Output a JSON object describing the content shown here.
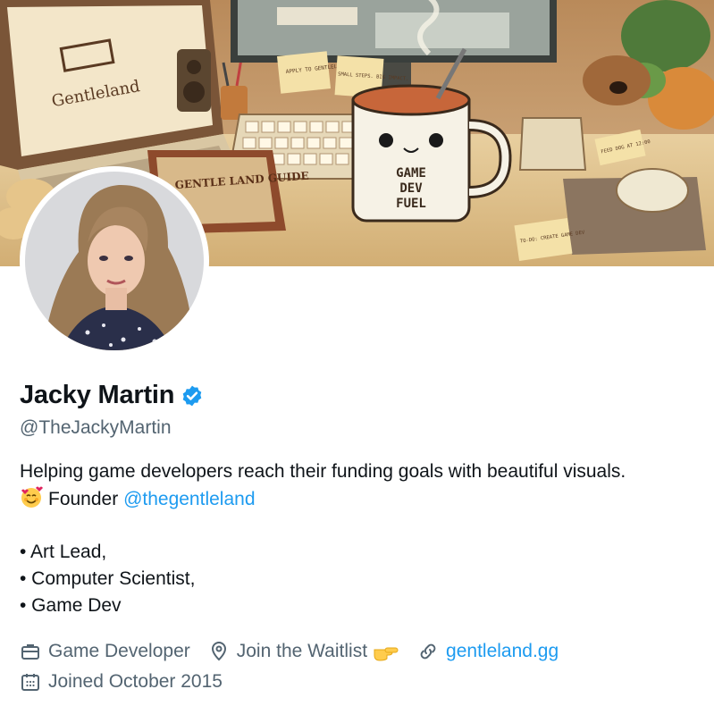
{
  "banner": {
    "laptop_logo": "Gentleland",
    "book_title": "GENTLE LAND GUIDE",
    "note_left": "APPLY TO GENTLELAND",
    "note_right": "SMALL STEPS. BIG IMPACT.",
    "mug_text": [
      "GAME",
      "DEV",
      "FUEL"
    ],
    "todo_note": "TO-DO: CREATE GAME DEV",
    "side_note": "FEED DOG AT 12:00"
  },
  "profile": {
    "name": "Jacky Martin",
    "handle": "@TheJackyMartin",
    "bio_line1": "Helping game developers reach their funding goals with beautiful visuals.",
    "bio_founder": "Founder",
    "bio_mention": "@thegentleland",
    "bio_list": [
      "• Art Lead,",
      "• Computer Scientist,",
      "• Game Dev"
    ]
  },
  "meta": {
    "profession": "Game Developer",
    "location": "Join the Waitlist",
    "website": "gentleland.gg",
    "joined": "Joined October 2015"
  },
  "icons": {
    "verified": "verified-badge-icon",
    "emoji": "smiling-face-with-hearts-emoji",
    "briefcase": "briefcase-icon",
    "location": "location-pin-icon",
    "pointing": "pointing-hand-emoji",
    "link": "link-icon",
    "calendar": "calendar-icon"
  },
  "colors": {
    "accent": "#1d9bf0",
    "secondary_text": "#536471",
    "primary_text": "#0f1419",
    "banner_warm": "#c9a36a"
  }
}
